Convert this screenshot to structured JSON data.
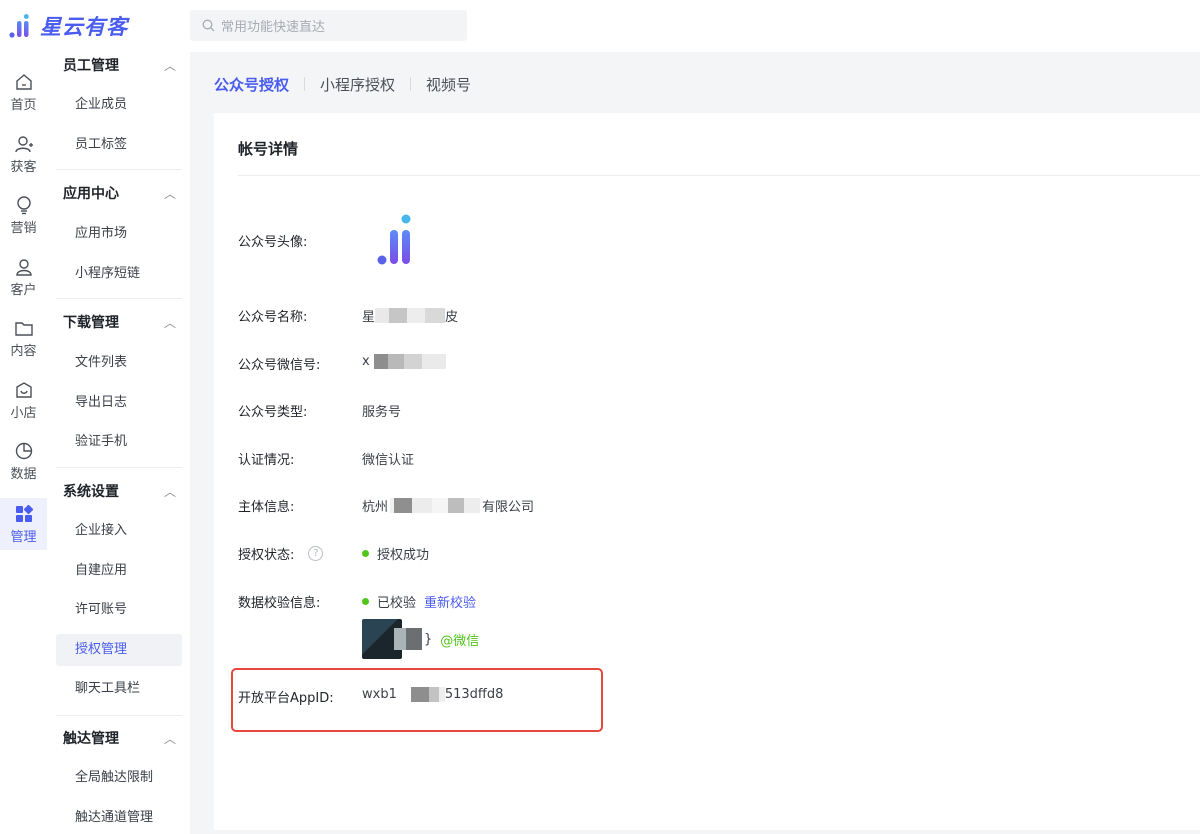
{
  "brand": {
    "name": "星云有客",
    "color": "#4a5df0"
  },
  "search": {
    "placeholder": "常用功能快速直达",
    "icon": "search-icon"
  },
  "rail": [
    {
      "label": "首页",
      "icon": "home-icon"
    },
    {
      "label": "获客",
      "icon": "user-add-icon"
    },
    {
      "label": "营销",
      "icon": "bulb-icon"
    },
    {
      "label": "客户",
      "icon": "user-icon"
    },
    {
      "label": "内容",
      "icon": "folder-icon"
    },
    {
      "label": "小店",
      "icon": "shop-icon"
    },
    {
      "label": "数据",
      "icon": "pie-chart-icon"
    },
    {
      "label": "管理",
      "icon": "grid-icon",
      "active": true
    }
  ],
  "menu": {
    "sections": [
      {
        "title": "员工管理",
        "items": [
          "企业成员",
          "员工标签"
        ]
      },
      {
        "title": "应用中心",
        "items": [
          "应用市场",
          "小程序短链"
        ]
      },
      {
        "title": "下载管理",
        "items": [
          "文件列表",
          "导出日志",
          "验证手机"
        ]
      },
      {
        "title": "系统设置",
        "items": [
          "企业接入",
          "自建应用",
          "许可账号",
          "授权管理",
          "聊天工具栏"
        ]
      },
      {
        "title": "触达管理",
        "items": [
          "全局触达限制",
          "触达通道管理"
        ]
      }
    ],
    "active_item": "授权管理"
  },
  "tabs": [
    "公众号授权",
    "小程序授权",
    "视频号"
  ],
  "card": {
    "title": "帐号详情",
    "rows": {
      "avatar": {
        "label": "公众号头像:"
      },
      "name": {
        "label": "公众号名称:",
        "value_start": "星",
        "value_end": "皮"
      },
      "wechat_id": {
        "label": "公众号微信号:",
        "value_start": "x"
      },
      "type": {
        "label": "公众号类型:",
        "value": "服务号"
      },
      "verify": {
        "label": "认证情况:",
        "value": "微信认证"
      },
      "subject": {
        "label": "主体信息:",
        "value_start": "杭州",
        "value_end": "有限公司"
      },
      "auth_status": {
        "label": "授权状态:",
        "value": "授权成功",
        "status_color": "#52c41a"
      },
      "data_check": {
        "label": "数据校验信息:",
        "value": "已校验",
        "action": "重新校验",
        "wechat_tag": "@微信",
        "tag_end": "}"
      },
      "appid": {
        "label": "开放平台AppID:",
        "value_start": "wxb1",
        "value_end": "513dffd8"
      }
    }
  },
  "highlight_color": "#e5483d"
}
